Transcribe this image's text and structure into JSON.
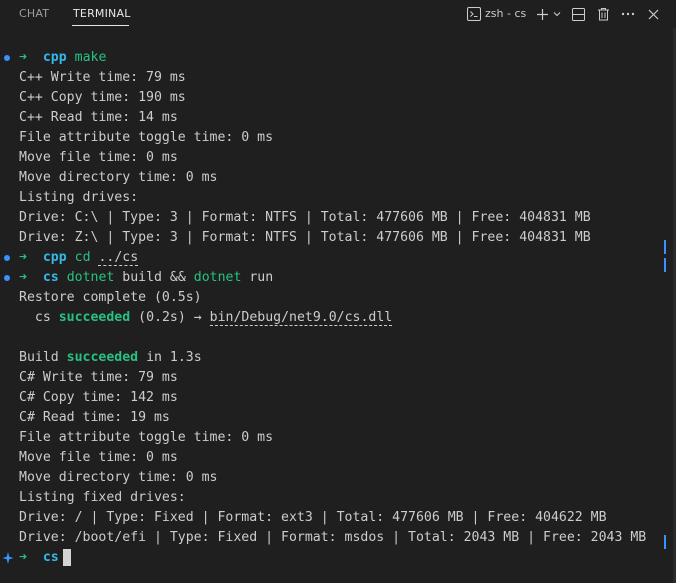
{
  "tabs": [
    {
      "label": "CHAT",
      "active": false
    },
    {
      "label": "TERMINAL",
      "active": true
    }
  ],
  "toolbar": {
    "terminal_label": "zsh - cs",
    "icons": [
      "terminal-icon",
      "plus-icon",
      "chevron-down-icon",
      "split-icon",
      "trash-icon",
      "more-icon",
      "close-icon"
    ]
  },
  "colors": {
    "background": "#1f1f1f",
    "text": "#cccccc",
    "prompt_arrow": "#26c281",
    "prompt_dir": "#35b9e9",
    "success": "#26c281",
    "marker": "#3794ff"
  },
  "terminal": {
    "prompt_arrow": "➜",
    "p1_dir": "cpp",
    "p1_cmd": "make",
    "out1": [
      "C++ Write time: 79 ms",
      "C++ Copy time: 190 ms",
      "C++ Read time: 14 ms",
      "File attribute toggle time: 0 ms",
      "Move file time: 0 ms",
      "Move directory time: 0 ms",
      "Listing drives:",
      "Drive: C:\\ | Type: 3 | Format: NTFS | Total: 477606 MB | Free: 404831 MB",
      "Drive: Z:\\ | Type: 3 | Format: NTFS | Total: 477606 MB | Free: 404831 MB"
    ],
    "p2_dir": "cpp",
    "p2_cmd": "cd",
    "p2_arg": "../cs",
    "p3_dir": "cs",
    "p3_cmd1": "dotnet",
    "p3_mid": "build &&",
    "p3_cmd2": "dotnet",
    "p3_end": "run",
    "restore": "Restore complete (0.5s)",
    "proj_name": "cs",
    "proj_status": "succeeded",
    "proj_time": "(0.2s) →",
    "proj_path": "bin/Debug/net9.0/cs.dll",
    "build_pre": "Build",
    "build_status": "succeeded",
    "build_post": "in 1.3s",
    "out2": [
      "C# Write time: 79 ms",
      "C# Copy time: 142 ms",
      "C# Read time: 19 ms",
      "File attribute toggle time: 0 ms",
      "Move file time: 0 ms",
      "Move directory time: 0 ms",
      "Listing fixed drives:",
      "Drive: / | Type: Fixed | Format: ext3 | Total: 477606 MB | Free: 404622 MB",
      "Drive: /boot/efi | Type: Fixed | Format: msdos | Total: 2043 MB | Free: 2043 MB"
    ],
    "p4_dir": "cs"
  }
}
